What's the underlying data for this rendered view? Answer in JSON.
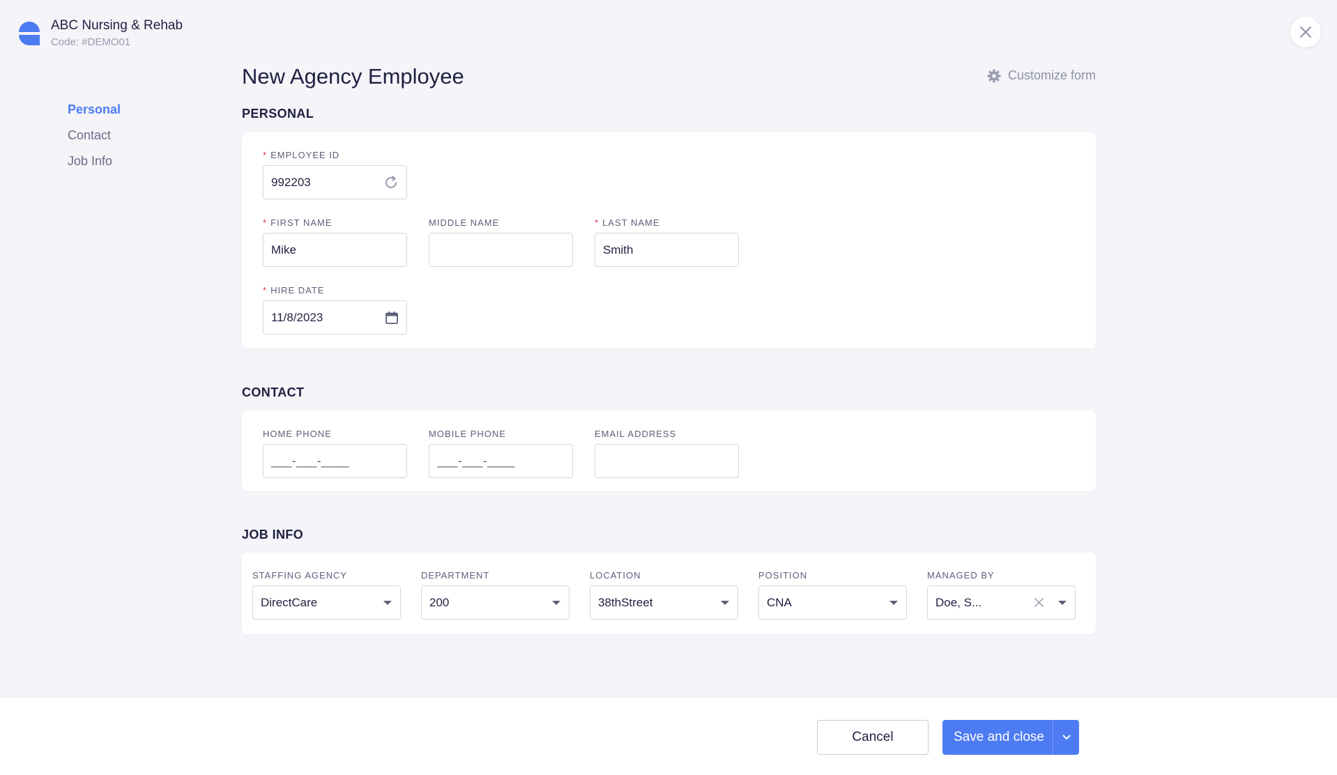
{
  "org": {
    "name": "ABC Nursing & Rehab",
    "code": "Code: #DEMO01",
    "brand_color": "#4d7bf3"
  },
  "nav": {
    "items": [
      {
        "label": "Personal",
        "active": true
      },
      {
        "label": "Contact",
        "active": false
      },
      {
        "label": "Job Info",
        "active": false
      }
    ]
  },
  "page": {
    "title": "New Agency Employee",
    "customize_label": "Customize form"
  },
  "personal": {
    "section_title": "PERSONAL",
    "employee_id": {
      "label": "EMPLOYEE ID",
      "value": "992203",
      "required": true,
      "icon": "refresh-icon"
    },
    "first_name": {
      "label": "FIRST NAME",
      "value": "Mike",
      "required": true
    },
    "middle_name": {
      "label": "MIDDLE NAME",
      "value": "",
      "required": false
    },
    "last_name": {
      "label": "LAST NAME",
      "value": "Smith",
      "required": true
    },
    "hire_date": {
      "label": "HIRE DATE",
      "value": "11/8/2023",
      "required": true,
      "icon": "calendar-icon"
    }
  },
  "contact": {
    "section_title": "CONTACT",
    "home_phone": {
      "label": "HOME PHONE",
      "value": "___-___-____"
    },
    "mobile_phone": {
      "label": "MOBILE PHONE",
      "value": "___-___-____"
    },
    "email": {
      "label": "EMAIL ADDRESS",
      "value": ""
    }
  },
  "job": {
    "section_title": "JOB INFO",
    "staffing_agency": {
      "label": "STAFFING AGENCY",
      "value": "DirectCare"
    },
    "department": {
      "label": "DEPARTMENT",
      "value": "200"
    },
    "location": {
      "label": "LOCATION",
      "value": "38thStreet"
    },
    "position": {
      "label": "POSITION",
      "value": "CNA"
    },
    "managed_by": {
      "label": "MANAGED BY",
      "value": "Doe, S..."
    }
  },
  "footer": {
    "cancel_label": "Cancel",
    "save_label": "Save and close"
  },
  "colors": {
    "accent": "#4d7bf3",
    "required": "#e0304d",
    "background": "#f4f4f9"
  }
}
